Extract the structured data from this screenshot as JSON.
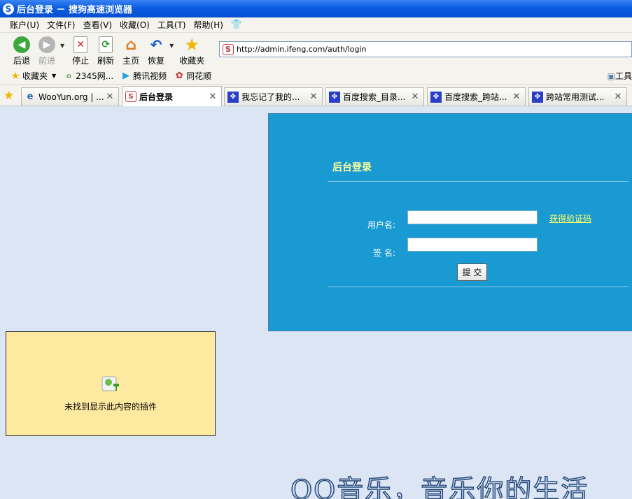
{
  "window": {
    "title": "后台登录 － 搜狗高速浏览器",
    "app_icon": "S"
  },
  "menu": [
    "账户(U)",
    "文件(F)",
    "查看(V)",
    "收藏(O)",
    "工具(T)",
    "帮助(H)"
  ],
  "toolbar": {
    "back": "后退",
    "forward": "前进",
    "stop": "停止",
    "refresh": "刷新",
    "home": "主页",
    "restore": "恢复",
    "favorites": "收藏夹",
    "address": "http://admin.ifeng.com/auth/login"
  },
  "favbar": {
    "favorites": "收藏夹",
    "items": [
      "2345网...",
      "腾讯视频",
      "同花顺"
    ],
    "tools": "工具"
  },
  "tabs": [
    {
      "title": "WooYun.org | ...",
      "active": false
    },
    {
      "title": "后台登录",
      "active": true
    },
    {
      "title": "我忘记了我的...",
      "active": false
    },
    {
      "title": "百度搜索_目录...",
      "active": false
    },
    {
      "title": "百度搜索_跨站...",
      "active": false
    },
    {
      "title": "跨站常用测试...",
      "active": false
    }
  ],
  "login": {
    "title": "后台登录",
    "username_label": "用户名:",
    "password_label": "签 名:",
    "username_value": "",
    "password_value": "",
    "captcha_link": "获得验证码",
    "submit": "提 交"
  },
  "plugin": {
    "message": "未找到显示此内容的插件"
  },
  "banner": {
    "text": "QQ音乐，音乐你的生活"
  },
  "colors": {
    "panel": "#1a9ad3",
    "titlebar": "#0a5be0",
    "plugin_bg": "#fde9a0"
  }
}
